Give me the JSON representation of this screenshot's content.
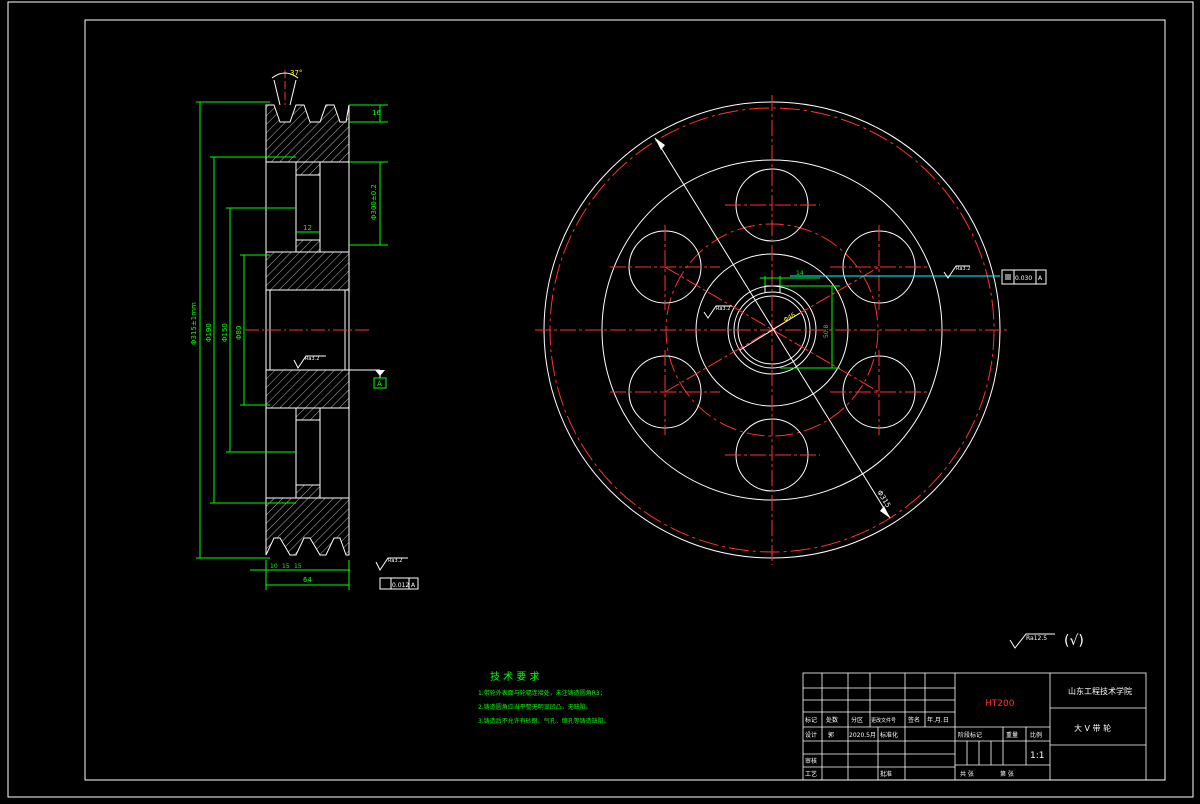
{
  "colors": {
    "background": "#000000",
    "outline": "#ffffff",
    "centerline": "#ff3030",
    "dimension": "#00ff00",
    "leader": "#00ffff",
    "text_yellow": "#ffff00",
    "material": "#ff3030"
  },
  "section_view": {
    "dim_angle": "37°",
    "dim_top": "16",
    "dim_overall_dia": "Φ315±1mm",
    "dim_dia_1": "Φ190",
    "dim_dia_2": "Φ150",
    "dim_dia_3": "Φ80",
    "dim_groove": "Φ300±0.2",
    "dim_inner": "12",
    "roughness_bore": "Ra3.2",
    "datum": "A",
    "roughness_face": "Ra3.2",
    "bottom_dims": [
      "10",
      "15",
      "15"
    ],
    "dim_width": "64",
    "tolerance_face": "0.012",
    "tolerance_face_datum": "A"
  },
  "front_view": {
    "dim_outer": "Φ315",
    "dim_keyway": "14",
    "dim_keyway_depth": "50.8",
    "dim_bore": "Φ46",
    "roughness_bore": "Ra3.2",
    "roughness_keyway": "Ra3.2",
    "tolerance_value": "0.030",
    "tolerance_datum": "A"
  },
  "general_roughness": {
    "value": "Ra12.5",
    "symbol": "(√)"
  },
  "tech_requirements": {
    "title": "技 术 要 求",
    "items": [
      "1.带轮外表面与轮辐连接处，未注铸造圆角R3；",
      "2.铸造圆角应当平整无明显凹凸，无缺陷。",
      "3.铸造后不允许有砂眼、气孔、缩孔等铸造缺陷。"
    ]
  },
  "title_block": {
    "material": "HT200",
    "school": "山东工程技术学院",
    "part_name": "大 V 带 轮",
    "header_row": [
      "标记",
      "处数",
      "分区",
      "更改文件号",
      "签名",
      "年.月.日"
    ],
    "design_row": [
      "设计",
      "郭",
      "2020.5月",
      "标准化"
    ],
    "stage_labels": [
      "阶段标记",
      "重量",
      "比例"
    ],
    "scale": "1:1",
    "approve_labels": [
      "审核",
      "工艺",
      "批准"
    ],
    "sheet_labels": [
      "共 张",
      "第 张"
    ]
  }
}
